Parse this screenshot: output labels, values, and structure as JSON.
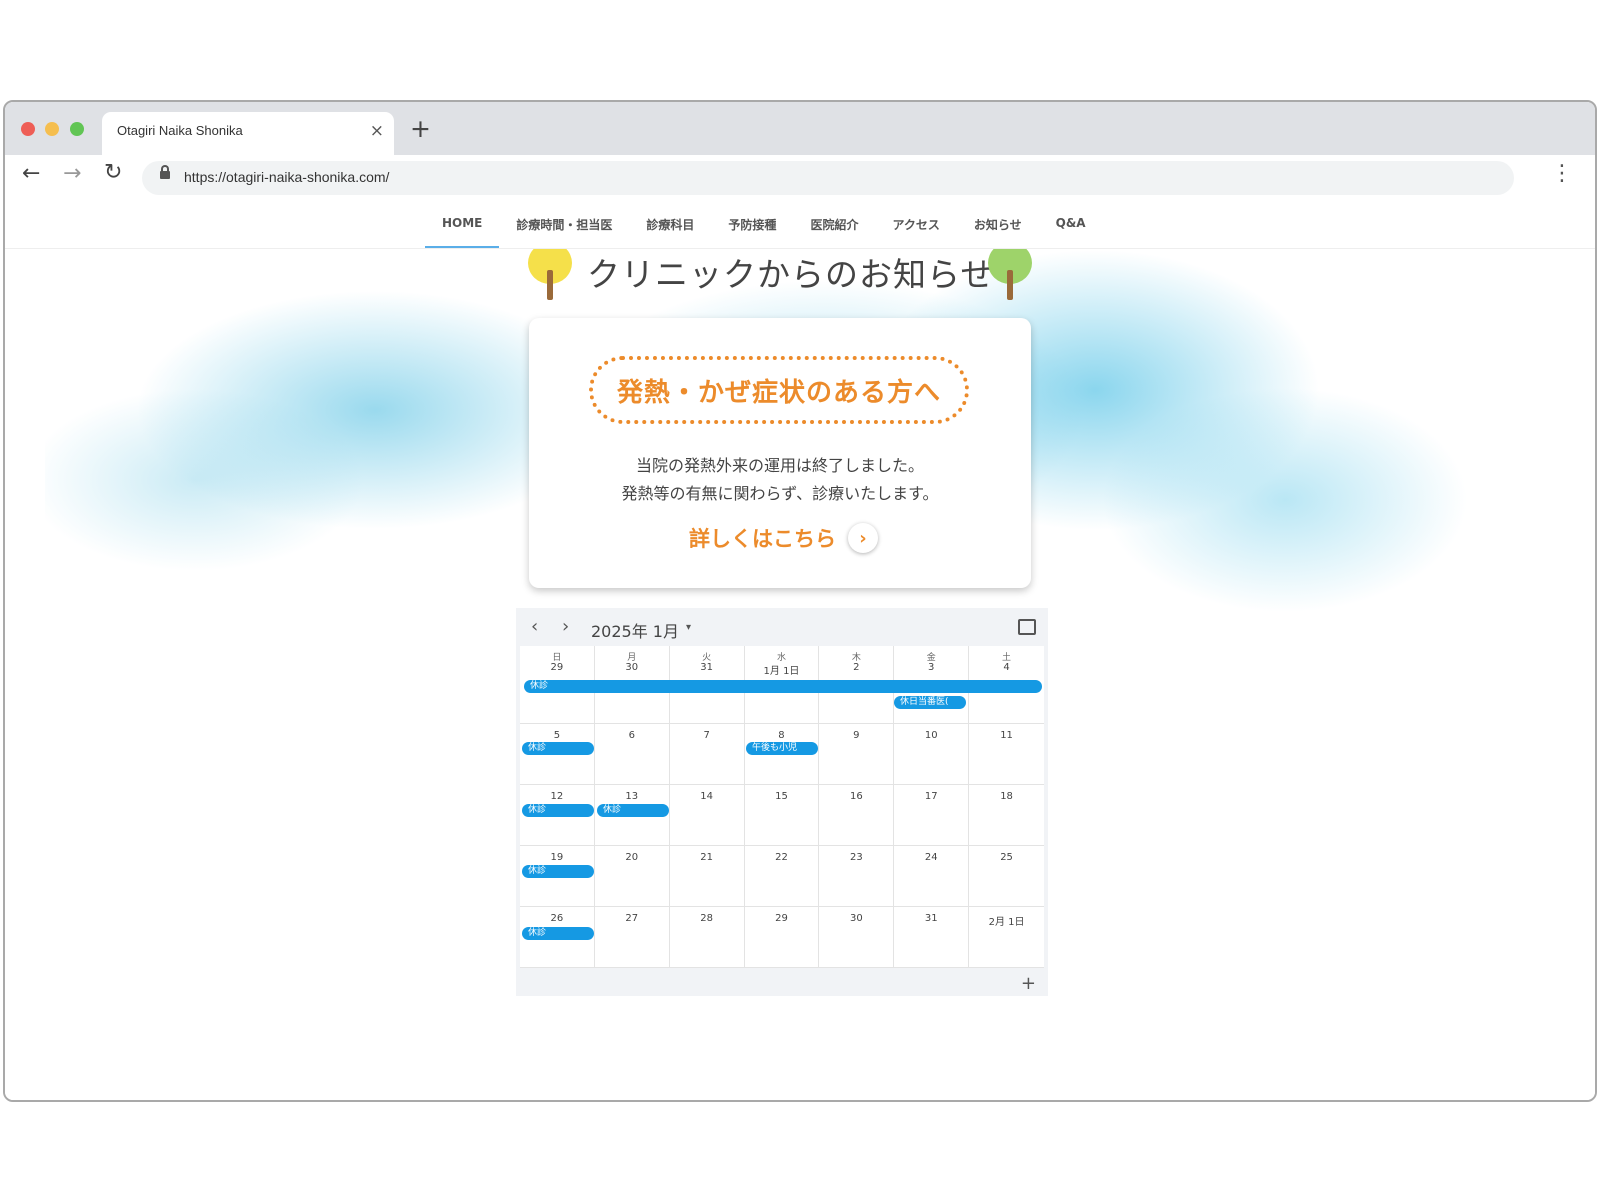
{
  "browser": {
    "tab_title": "Otagiri Naika Shonika",
    "close_glyph": "×",
    "new_tab_glyph": "+",
    "url": "https://otagiri-naika-shonika.com/",
    "back_glyph": "←",
    "forward_glyph": "→",
    "reload_glyph": "↻",
    "menu_glyph": "⋮"
  },
  "nav": {
    "items": [
      "HOME",
      "診療時間・担当医",
      "診療科目",
      "予防接種",
      "医院紹介",
      "アクセス",
      "お知らせ",
      "Q&A"
    ],
    "active_index": 0
  },
  "hero": {
    "title": "クリニックからのお知らせ"
  },
  "notice": {
    "badge": "発熱・かぜ症状のある方へ",
    "line1": "当院の発熱外来の運用は終了しました。",
    "line2": "発熱等の有無に関わらず、診療いたします。",
    "more_label": "詳しくはこちら",
    "more_arrow": "›"
  },
  "calendar": {
    "prev_glyph": "‹",
    "next_glyph": "›",
    "month_label": "2025年 1月",
    "caret": "▾",
    "add_glyph": "+",
    "weekdays": [
      "日",
      "月",
      "火",
      "水",
      "木",
      "金",
      "土"
    ],
    "dates": [
      [
        "29",
        "30",
        "31",
        "1月 1日",
        "2",
        "3",
        "4"
      ],
      [
        "5",
        "6",
        "7",
        "8",
        "9",
        "10",
        "11"
      ],
      [
        "12",
        "13",
        "14",
        "15",
        "16",
        "17",
        "18"
      ],
      [
        "19",
        "20",
        "21",
        "22",
        "23",
        "24",
        "25"
      ],
      [
        "26",
        "27",
        "28",
        "29",
        "30",
        "31",
        "2月 1日"
      ]
    ],
    "events": {
      "week1_holiday": "休診",
      "week1_duty": "休日当番医(",
      "week2_sun": "休診",
      "week2_wed": "午後も小児",
      "week3_sun": "休診",
      "week3_mon": "休診",
      "week4_sun": "休診",
      "week5_sun": "休診"
    },
    "event_color": "#1599e3"
  },
  "colors": {
    "accent_orange": "#ec8b2b",
    "nav_active": "#5aaee8",
    "sky": "#7fd0e8"
  },
  "icons": {
    "lock": "lock-icon",
    "tree_left": "yellow-tree-icon",
    "tree_right": "green-tree-icon",
    "comment": "comment-icon"
  }
}
